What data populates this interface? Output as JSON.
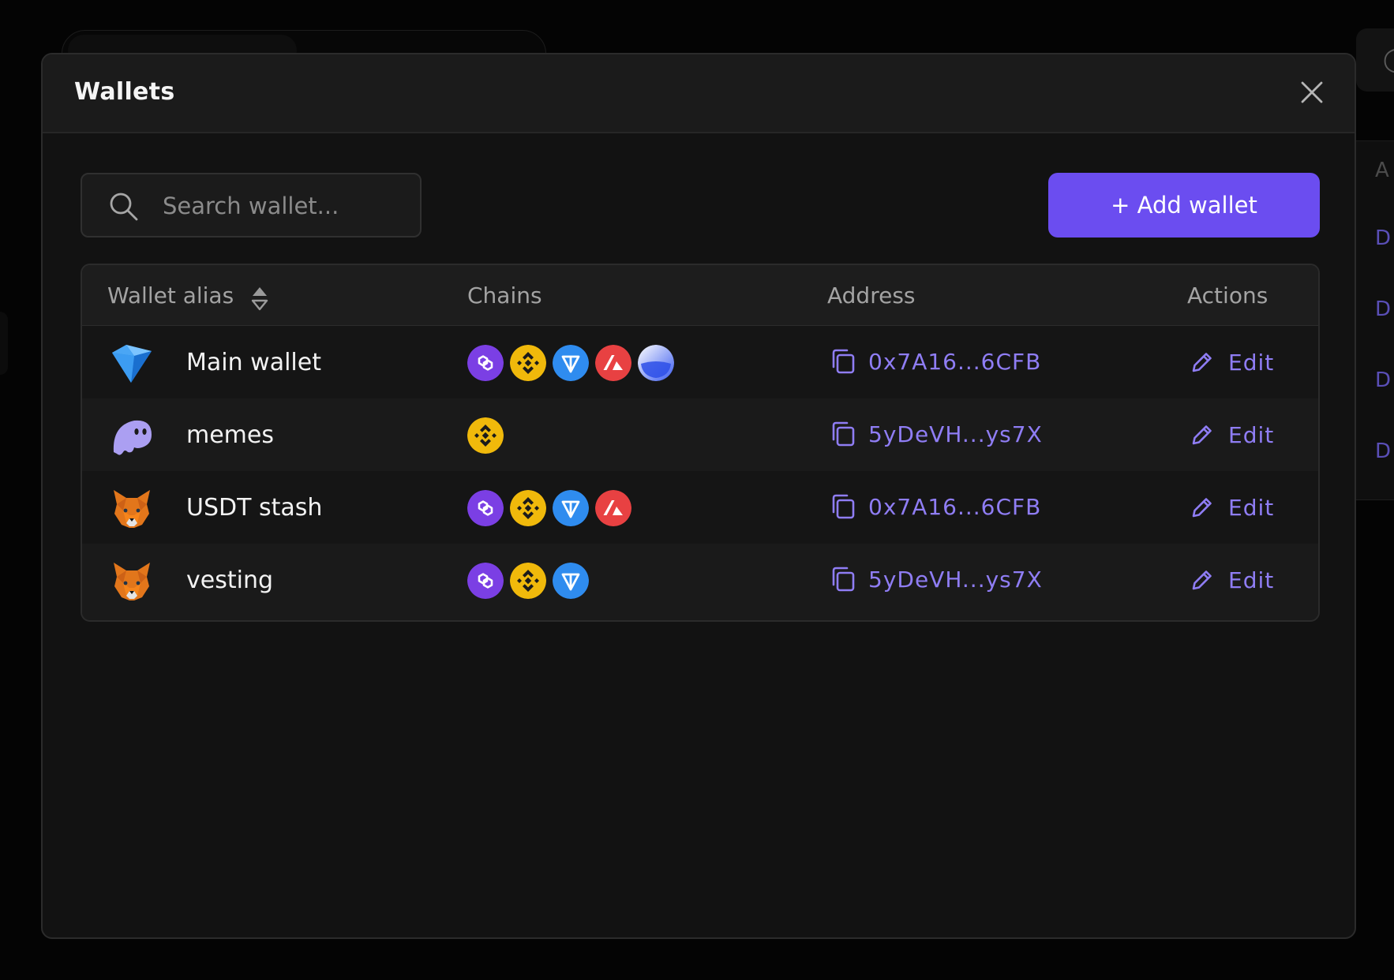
{
  "modal": {
    "title": "Wallets",
    "search_placeholder": "Search wallet...",
    "add_button_label": "+ Add wallet"
  },
  "table": {
    "headers": {
      "alias": "Wallet alias",
      "chains": "Chains",
      "address": "Address",
      "actions": "Actions"
    },
    "rows": [
      {
        "alias": "Main wallet",
        "wallet_icon": "diamond-wallet-icon",
        "chains": [
          "polygon",
          "bnb",
          "ton",
          "avalanche",
          "sui"
        ],
        "address": "0x7A16...6CFB",
        "action": "Edit"
      },
      {
        "alias": "memes",
        "wallet_icon": "ghost-wallet-icon",
        "chains": [
          "bnb"
        ],
        "address": "5yDeVH...ys7X",
        "action": "Edit"
      },
      {
        "alias": "USDT stash",
        "wallet_icon": "fox-wallet-icon",
        "chains": [
          "polygon",
          "bnb",
          "ton",
          "avalanche"
        ],
        "address": "0x7A16...6CFB",
        "action": "Edit"
      },
      {
        "alias": "vesting",
        "wallet_icon": "fox-wallet-icon",
        "chains": [
          "polygon",
          "bnb",
          "ton"
        ],
        "address": "5yDeVH...ys7X",
        "action": "Edit"
      }
    ]
  },
  "background": {
    "right_header_fragment": "A",
    "right_row_fragments": [
      "D",
      "D",
      "D",
      "D"
    ]
  },
  "colors": {
    "accent": "#6b4df0",
    "link": "#8f7df4",
    "polygon": "#7b3fe4",
    "bnb": "#f0b90b",
    "ton": "#2f8cef",
    "avalanche": "#e84142",
    "background": "#040404",
    "modal": "#121212"
  }
}
